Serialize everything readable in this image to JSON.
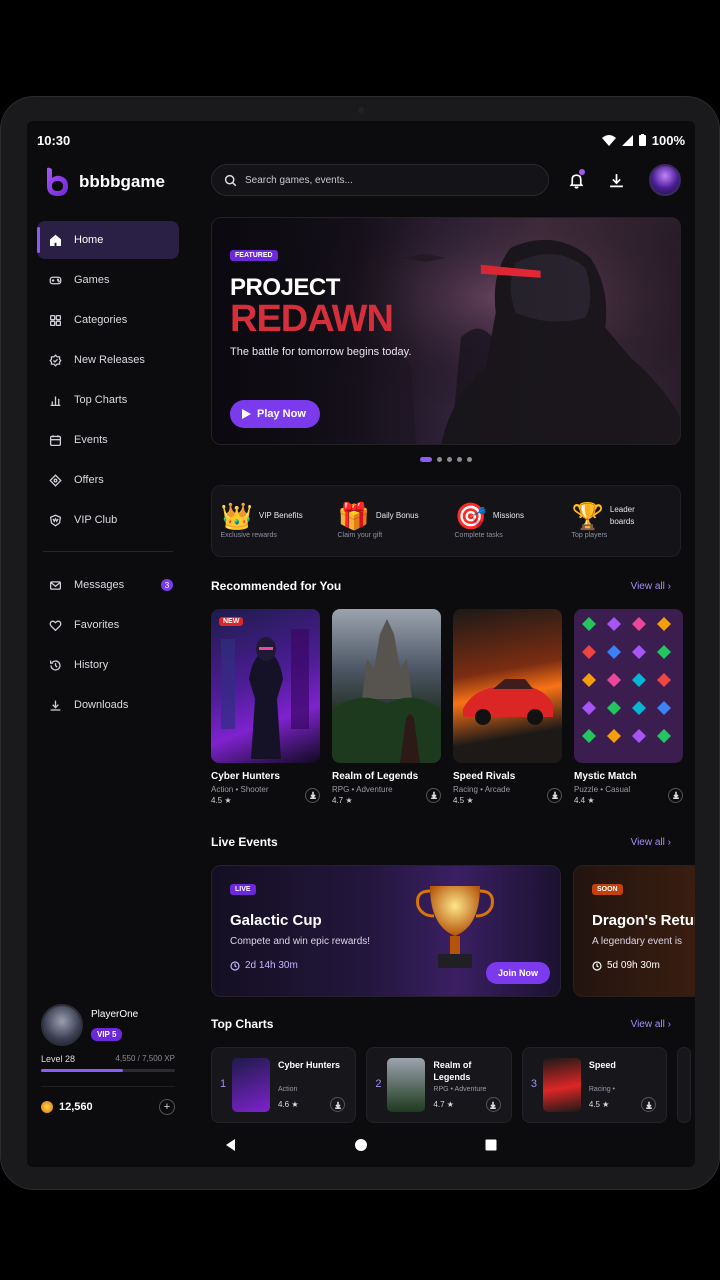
{
  "status": {
    "time": "10:30",
    "battery": "100%"
  },
  "brand": {
    "name": "bbbbgame"
  },
  "nav": {
    "items": [
      {
        "label": "Home",
        "icon": "home-icon"
      },
      {
        "label": "Games",
        "icon": "gamepad-icon"
      },
      {
        "label": "Categories",
        "icon": "grid-icon"
      },
      {
        "label": "New Releases",
        "icon": "new-icon"
      },
      {
        "label": "Top Charts",
        "icon": "bar-chart-icon"
      },
      {
        "label": "Events",
        "icon": "calendar-icon"
      },
      {
        "label": "Offers",
        "icon": "tag-icon"
      },
      {
        "label": "VIP Club",
        "icon": "crown-icon"
      }
    ],
    "secondary": [
      {
        "label": "Messages",
        "icon": "mail-icon",
        "badge": "3"
      },
      {
        "label": "Favorites",
        "icon": "heart-icon"
      },
      {
        "label": "History",
        "icon": "history-icon"
      },
      {
        "label": "Downloads",
        "icon": "download-icon"
      }
    ]
  },
  "profile": {
    "name": "PlayerOne",
    "vip": "VIP 5",
    "level": "Level 28",
    "xp": "4,550 / 7,500 XP",
    "xp_fraction": 0.61,
    "coins": "12,560"
  },
  "search": {
    "placeholder": "Search games, events..."
  },
  "hero": {
    "tag": "FEATURED",
    "title_line1": "PROJECT",
    "title_line2": "REDAWN",
    "subtitle": "The battle for tomorrow begins today.",
    "cta": "Play Now"
  },
  "perks": [
    {
      "title": "VIP Benefits",
      "subtitle": "Exclusive rewards",
      "icon": "crown-icon"
    },
    {
      "title": "Daily Bonus",
      "subtitle": "Claim your gift",
      "icon": "gift-icon"
    },
    {
      "title": "Missions",
      "subtitle": "Complete tasks",
      "icon": "target-icon"
    },
    {
      "title": "Leader boards",
      "subtitle": "Top players",
      "icon": "trophy-icon"
    }
  ],
  "recommended": {
    "title": "Recommended for You",
    "view_all": "View all",
    "games": [
      {
        "name": "Cyber Hunters",
        "genre": "Action • Shooter",
        "rating": "4.5 ★",
        "tag": "NEW"
      },
      {
        "name": "Realm of Legends",
        "genre": "RPG • Adventure",
        "rating": "4.7 ★",
        "tag": ""
      },
      {
        "name": "Speed Rivals",
        "genre": "Racing • Arcade",
        "rating": "4.5 ★",
        "tag": ""
      },
      {
        "name": "Mystic Match",
        "genre": "Puzzle • Casual",
        "rating": "4.4 ★",
        "tag": ""
      }
    ]
  },
  "live_events": {
    "title": "Live Events",
    "view_all": "View all",
    "events": [
      {
        "tag": "LIVE",
        "title": "Galactic Cup",
        "subtitle": "Compete and win epic rewards!",
        "time": "2d 14h 30m",
        "cta": "Join Now"
      },
      {
        "tag": "SOON",
        "title": "Dragon's Return",
        "subtitle": "A legendary event is",
        "time": "5d 09h 30m"
      }
    ]
  },
  "top_charts": {
    "title": "Top Charts",
    "view_all": "View all",
    "items": [
      {
        "rank": "1",
        "name": "Cyber Hunters",
        "genre": "Action",
        "rating": "4.6 ★"
      },
      {
        "rank": "2",
        "name": "Realm of Legends",
        "genre": "RPG • Adventure",
        "rating": "4.7 ★"
      },
      {
        "rank": "3",
        "name": "Speed",
        "genre": "Racing •",
        "rating": "4.5 ★"
      }
    ]
  },
  "colors": {
    "accent": "#7c3aed",
    "live": "#6d28d9",
    "soon": "#c2410c",
    "new_tag": "#dc2626"
  }
}
